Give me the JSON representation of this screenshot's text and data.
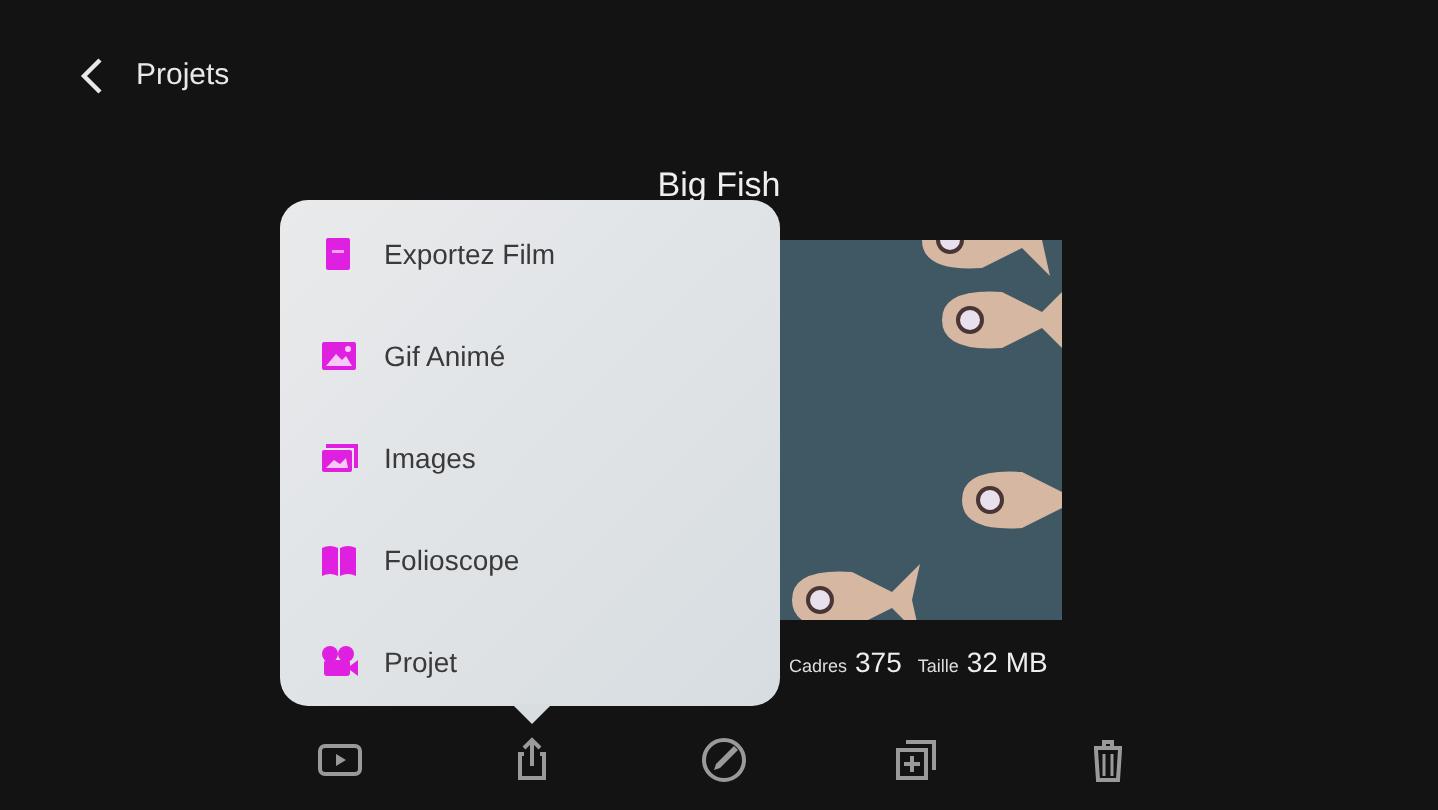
{
  "header": {
    "back_label": "Projets"
  },
  "project": {
    "title": "Big Fish",
    "stats": [
      {
        "label": "Cadres",
        "value": "375"
      },
      {
        "label": "Taille",
        "value": "32 MB"
      }
    ]
  },
  "share_menu": {
    "items": [
      {
        "label": "Exportez Film",
        "kind": "film"
      },
      {
        "label": "Gif Animé",
        "kind": "gif"
      },
      {
        "label": "Images",
        "kind": "images"
      },
      {
        "label": "Folioscope",
        "kind": "book"
      },
      {
        "label": "Projet",
        "kind": "camera"
      }
    ]
  },
  "toolbar": {
    "buttons": [
      {
        "kind": "play"
      },
      {
        "kind": "share"
      },
      {
        "kind": "edit"
      },
      {
        "kind": "duplicate"
      },
      {
        "kind": "trash"
      }
    ]
  }
}
